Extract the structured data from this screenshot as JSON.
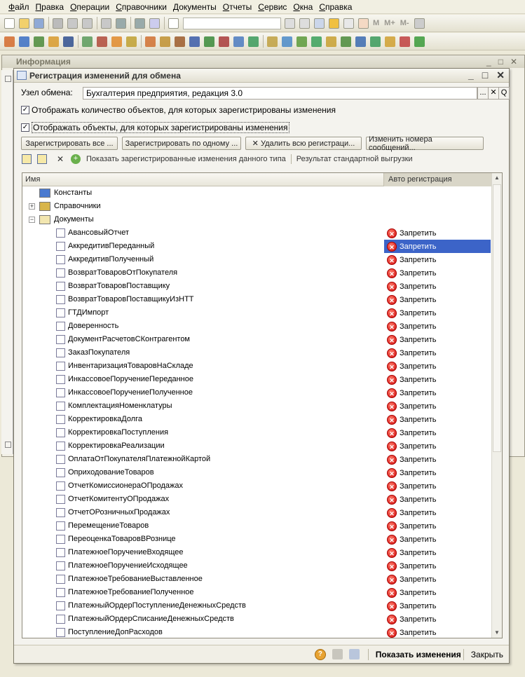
{
  "menu": [
    "Файл",
    "Правка",
    "Операции",
    "Справочники",
    "Документы",
    "Отчеты",
    "Сервис",
    "Окна",
    "Справка"
  ],
  "toolbar_text": [
    "М",
    "М+",
    "М-"
  ],
  "bg_window": {
    "title": "Информация",
    "controls": [
      "_",
      "□",
      "✕"
    ]
  },
  "dialog": {
    "title": "Регистрация изменений для обмена",
    "controls": [
      "_",
      "□",
      "✕"
    ],
    "node_label": "Узел обмена:",
    "node_value": "Бухгалтерия предприятия, редакция 3.0",
    "node_btn_select": "...",
    "node_btn_clear": "✕",
    "node_btn_open": "Q",
    "check1": {
      "label": "Отображать количество объектов, для которых зарегистрированы изменения",
      "checked": true
    },
    "check2": {
      "label": "Отображать объекты, для которых зарегистрированы изменения",
      "checked": true
    },
    "buttons": [
      "Зарегистрировать все ...",
      "Зарегистрировать по одному ...",
      "✕ Удалить всю регистраци...",
      "Изменить номера сообщений..."
    ],
    "toolbar_show": "Показать зарегистрированные изменения данного типа",
    "toolbar_result": "Результат стандартной выгрузки",
    "col_name": "Имя",
    "col_auto": "Авто регистрация",
    "groups": [
      "Константы",
      "Справочники",
      "Документы"
    ],
    "deny": "Запретить",
    "docs": [
      "АвансовыйОтчет",
      "АккредитивПереданный",
      "АккредитивПолученный",
      "ВозвратТоваровОтПокупателя",
      "ВозвратТоваровПоставщику",
      "ВозвратТоваровПоставщикуИзНТТ",
      "ГТДИмпорт",
      "Доверенность",
      "ДокументРасчетовСКонтрагентом",
      "ЗаказПокупателя",
      "ИнвентаризацияТоваровНаСкладе",
      "ИнкассовоеПоручениеПереданное",
      "ИнкассовоеПоручениеПолученное",
      "КомплектацияНоменклатуры",
      "КорректировкаДолга",
      "КорректировкаПоступления",
      "КорректировкаРеализации",
      "ОплатаОтПокупателяПлатежнойКартой",
      "ОприходованиеТоваров",
      "ОтчетКомиссионераОПродажах",
      "ОтчетКомитентуОПродажах",
      "ОтчетОРозничныхПродажах",
      "ПеремещениеТоваров",
      "ПереоценкаТоваровВРознице",
      "ПлатежноеПоручениеВходящее",
      "ПлатежноеПоручениеИсходящее",
      "ПлатежноеТребованиеВыставленное",
      "ПлатежноеТребованиеПолученное",
      "ПлатежныйОрдерПоступлениеДенежныхСредств",
      "ПлатежныйОрдерСписаниеДенежныхСредств",
      "ПоступлениеДопРасходов"
    ],
    "selected_doc": "АккредитивПереданный",
    "footer_show": "Показать изменения",
    "footer_close": "Закрыть",
    "colors": {
      "selection": "#3c64c8",
      "deny_icon": "#d10a0a"
    }
  }
}
